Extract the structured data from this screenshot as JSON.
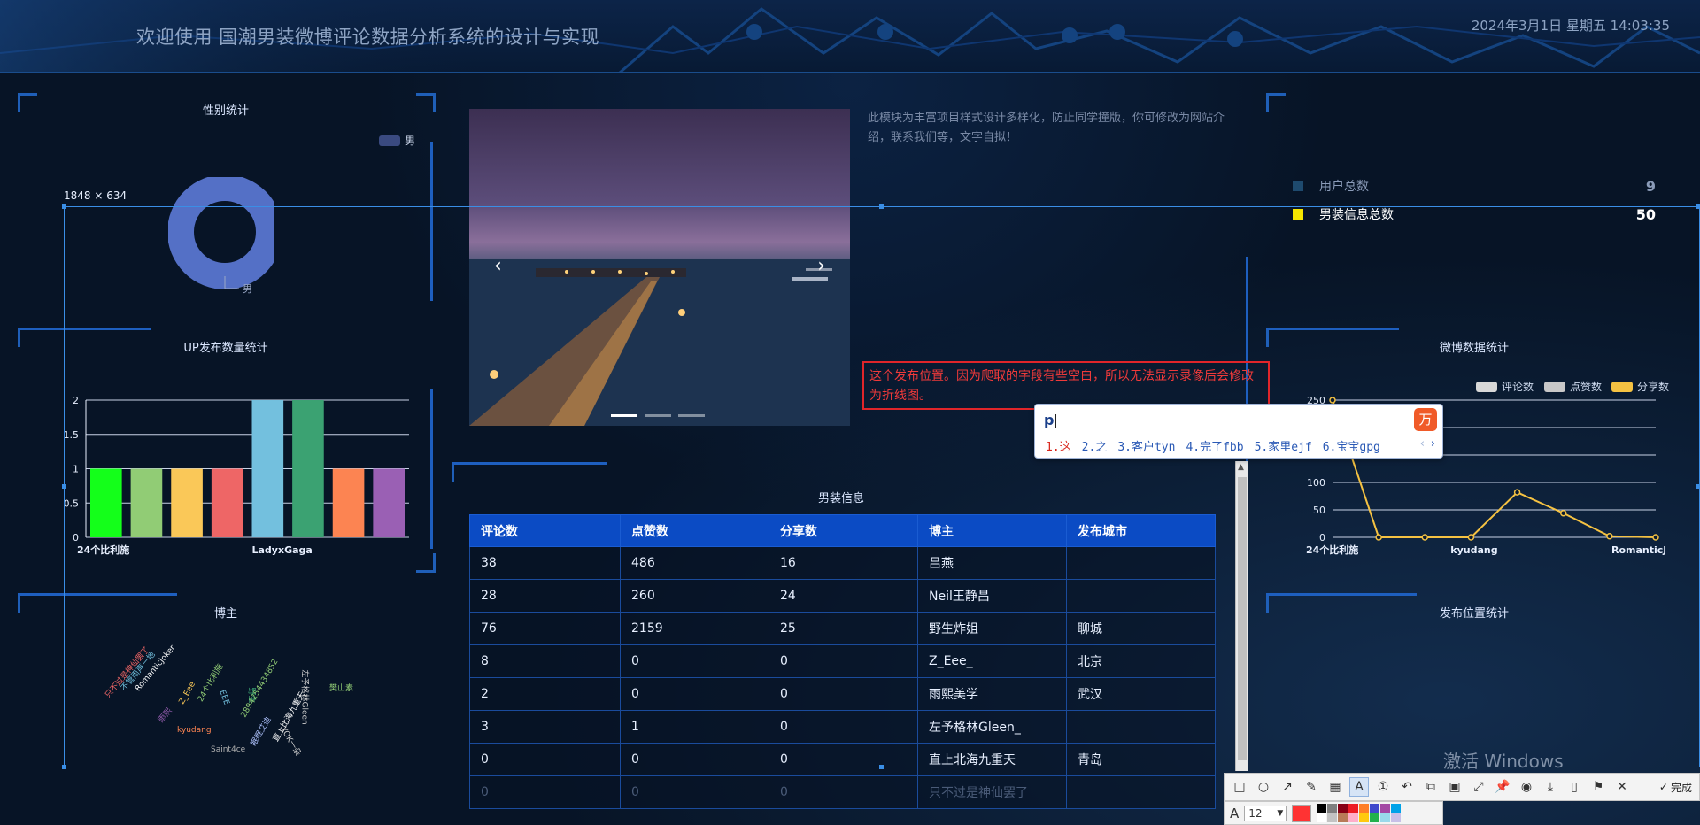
{
  "header": {
    "title": "欢迎使用 国潮男装微博评论数据分析系统的设计与实现",
    "datetime": "2024年3月1日 星期五 14:03:35"
  },
  "gender_panel": {
    "title": "性别统计",
    "legend": "男",
    "slice_label": "男",
    "chart_data": {
      "type": "pie",
      "categories": [
        "男"
      ],
      "values": [
        1
      ],
      "colors": [
        "#5470c6"
      ],
      "legend_position": "top-right"
    }
  },
  "up_panel": {
    "title": "UP发布数量统计",
    "chart_data": {
      "type": "bar",
      "categories": [
        "24个比利施",
        "",
        "",
        "",
        "LadyxGaga",
        "",
        "",
        ""
      ],
      "tick_labels": [
        "24个比利施",
        "LadyxGaga"
      ],
      "values": [
        1,
        1,
        1,
        1,
        2,
        2,
        1,
        1
      ],
      "colors": [
        "#14ff1a",
        "#91cc75",
        "#fac858",
        "#ee6666",
        "#73c0de",
        "#3ba272",
        "#fc8452",
        "#9a60b4"
      ],
      "y_ticks": [
        "0",
        "0.5",
        "1",
        "1.5",
        "2"
      ],
      "ylim": [
        0,
        2
      ],
      "grid": true
    }
  },
  "blogger_panel": {
    "title": "博主",
    "words": [
      {
        "text": "只不过是神仙罢了",
        "color": "#ee6666",
        "rot": -50
      },
      {
        "text": "不管雨声一地",
        "color": "#73c0de",
        "rot": -50
      },
      {
        "text": "RomanticJoker",
        "color": "#ffffff",
        "rot": -50
      },
      {
        "text": "雨熙",
        "color": "#9a60b4",
        "rot": -50
      },
      {
        "text": "kyudang",
        "color": "#fc8452",
        "rot": 0
      },
      {
        "text": "Z_Eee",
        "color": "#fac858",
        "rot": -60
      },
      {
        "text": "24个比利施",
        "color": "#91cc75",
        "rot": -60
      },
      {
        "text": "EEE",
        "color": "#73c0de",
        "rot": 70
      },
      {
        "text": "野生",
        "color": "#3ba272",
        "rot": 90
      },
      {
        "text": "2894254434852",
        "color": "#91cc75",
        "rot": -60
      },
      {
        "text": "Saint4ce",
        "color": "#b0b0b0",
        "rot": 0
      },
      {
        "text": "眠眠艾迪",
        "color": "#b0c4ff",
        "rot": -60
      },
      {
        "text": "直上比海九重天",
        "color": "#ffffff",
        "rot": -60
      },
      {
        "text": "YOK一朵",
        "color": "#d0d0d0",
        "rot": 60
      },
      {
        "text": "左予格林Gleen",
        "color": "#d0d0d0",
        "rot": 90
      },
      {
        "text": "樊山素",
        "color": "#91cc75",
        "rot": 0
      }
    ]
  },
  "carousel": {
    "prev": "‹",
    "next": "›",
    "slides": 3,
    "active_slide": 1
  },
  "intro": {
    "text": "此模块为丰富项目样式设计多样化，防止同学撞版，你可修改为网站介绍，联系我们等，文字自拟！"
  },
  "stats": {
    "items": [
      {
        "label": "用户总数",
        "value": "9",
        "color": "#1e4a6e",
        "label_color": "#8a9bb8",
        "value_color": "#8a9bb8"
      },
      {
        "label": "男装信息总数",
        "value": "50",
        "color": "#f5e600",
        "label_color": "#ffffff",
        "value_color": "#ffffff"
      }
    ]
  },
  "weibo_panel": {
    "title": "微博数据统计",
    "legend": [
      "评论数",
      "点赞数",
      "分享数"
    ],
    "legend_colors": [
      "#d8d8d8",
      "#c8c8c8",
      "#f5c242"
    ],
    "chart_data": {
      "type": "line",
      "x_ticks": [
        "24个比利施",
        "kyudang",
        "RomanticJoker"
      ],
      "y_ticks": [
        "0",
        "50",
        "100",
        "150",
        "200",
        "250"
      ],
      "ylim": [
        0,
        250
      ],
      "series": [
        {
          "name": "分享数",
          "values": [
            250,
            0,
            0,
            0,
            82,
            44,
            2,
            0
          ],
          "color": "#f5c242"
        }
      ],
      "grid": true
    }
  },
  "location_panel": {
    "title": "发布位置统计"
  },
  "table": {
    "title": "男装信息",
    "columns": [
      "评论数",
      "点赞数",
      "分享数",
      "博主",
      "发布城市"
    ],
    "rows": [
      [
        "38",
        "486",
        "16",
        "吕燕",
        ""
      ],
      [
        "28",
        "260",
        "24",
        "Neil王静昌",
        ""
      ],
      [
        "76",
        "2159",
        "25",
        "野生炸姐",
        "聊城"
      ],
      [
        "8",
        "0",
        "0",
        "Z_Eee_",
        "北京"
      ],
      [
        "2",
        "0",
        "0",
        "雨熙美学",
        "武汉"
      ],
      [
        "3",
        "1",
        "0",
        "左予格林Gleen_",
        ""
      ],
      [
        "0",
        "0",
        "0",
        "直上北海九重天",
        "青岛"
      ],
      [
        "0",
        "0",
        "0",
        "只不过是神仙罢了",
        ""
      ]
    ]
  },
  "annotation": {
    "note": "这个发布位置。因为爬取的字段有些空白，所以无法显示录像后会修改为折线图。",
    "selection_size": "1848 × 634"
  },
  "ime": {
    "typed": "p",
    "candidates": [
      "1.这",
      "2.之",
      "3.客户tyn",
      "4.完了fbb",
      "5.家里ejf",
      "6.宝宝gpg"
    ],
    "logo": "万"
  },
  "watermark": "激活 Windows",
  "capture_toolbar": {
    "done_label": "完成",
    "font_size": "12",
    "current_color": "#ff3333",
    "palette": [
      "#000000",
      "#7f7f7f",
      "#880015",
      "#ed1c24",
      "#ff7f27",
      "#3f48cc",
      "#a349a4",
      "#00a2e8",
      "#ffffff",
      "#c3c3c3",
      "#b97a57",
      "#ffaec9",
      "#ffc90e",
      "#22b14c",
      "#99d9ea",
      "#c8bfe7"
    ]
  }
}
